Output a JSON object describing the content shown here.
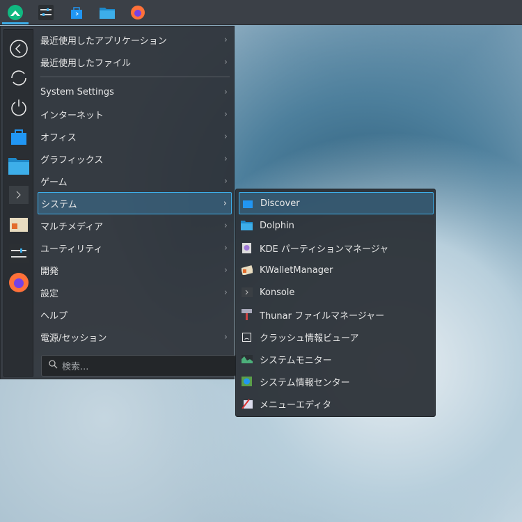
{
  "taskbar": {
    "icons": [
      "app-launcher-icon",
      "system-settings-icon",
      "discover-icon",
      "dolphin-icon",
      "firefox-icon"
    ]
  },
  "menu": {
    "sidebar": [
      "back-icon",
      "refresh-icon",
      "power-icon",
      "discover-icon",
      "dolphin-icon",
      "konsole-icon",
      "kwallet-icon",
      "system-settings-icon",
      "firefox-icon"
    ],
    "items": [
      {
        "label": "最近使用したアプリケーション"
      },
      {
        "label": "最近使用したファイル"
      },
      {
        "label": "System Settings"
      },
      {
        "label": "インターネット"
      },
      {
        "label": "オフィス"
      },
      {
        "label": "グラフィックス"
      },
      {
        "label": "ゲーム"
      },
      {
        "label": "システム"
      },
      {
        "label": "マルチメディア"
      },
      {
        "label": "ユーティリティ"
      },
      {
        "label": "開発"
      },
      {
        "label": "設定"
      },
      {
        "label": "ヘルプ"
      },
      {
        "label": "電源/セッション"
      }
    ],
    "chevron": "›",
    "search_placeholder": "検索..."
  },
  "submenu": {
    "items": [
      {
        "label": "Discover"
      },
      {
        "label": "Dolphin"
      },
      {
        "label": "KDE パーティションマネージャ"
      },
      {
        "label": "KWalletManager"
      },
      {
        "label": "Konsole"
      },
      {
        "label": "Thunar ファイルマネージャー"
      },
      {
        "label": "クラッシュ情報ビューア"
      },
      {
        "label": "システムモニター"
      },
      {
        "label": "システム情報センター"
      },
      {
        "label": "メニューエディタ"
      }
    ]
  },
  "colors": {
    "accent": "#3daee9",
    "panel": "#2d3238"
  }
}
